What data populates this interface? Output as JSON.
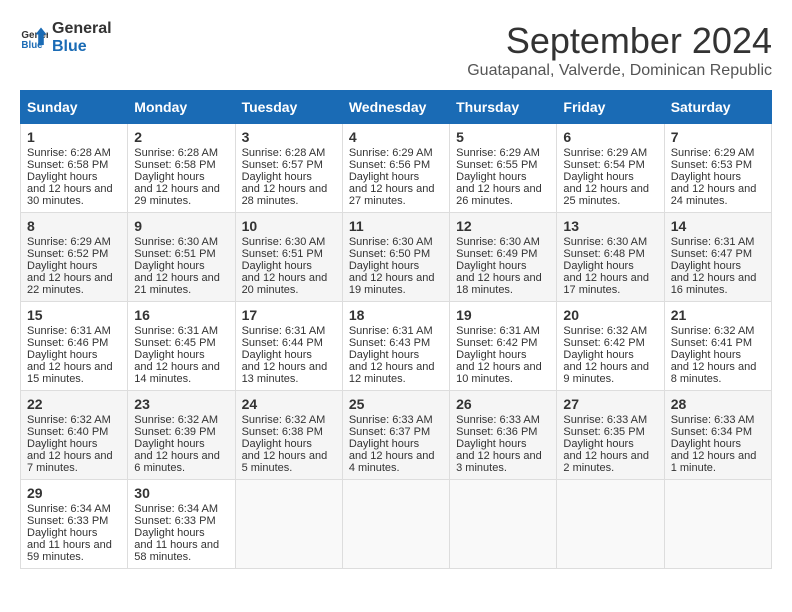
{
  "logo": {
    "line1": "General",
    "line2": "Blue"
  },
  "title": "September 2024",
  "subtitle": "Guatapanal, Valverde, Dominican Republic",
  "weekdays": [
    "Sunday",
    "Monday",
    "Tuesday",
    "Wednesday",
    "Thursday",
    "Friday",
    "Saturday"
  ],
  "weeks": [
    [
      {
        "day": "1",
        "sunrise": "6:28 AM",
        "sunset": "6:58 PM",
        "daylight": "12 hours and 30 minutes."
      },
      {
        "day": "2",
        "sunrise": "6:28 AM",
        "sunset": "6:58 PM",
        "daylight": "12 hours and 29 minutes."
      },
      {
        "day": "3",
        "sunrise": "6:28 AM",
        "sunset": "6:57 PM",
        "daylight": "12 hours and 28 minutes."
      },
      {
        "day": "4",
        "sunrise": "6:29 AM",
        "sunset": "6:56 PM",
        "daylight": "12 hours and 27 minutes."
      },
      {
        "day": "5",
        "sunrise": "6:29 AM",
        "sunset": "6:55 PM",
        "daylight": "12 hours and 26 minutes."
      },
      {
        "day": "6",
        "sunrise": "6:29 AM",
        "sunset": "6:54 PM",
        "daylight": "12 hours and 25 minutes."
      },
      {
        "day": "7",
        "sunrise": "6:29 AM",
        "sunset": "6:53 PM",
        "daylight": "12 hours and 24 minutes."
      }
    ],
    [
      {
        "day": "8",
        "sunrise": "6:29 AM",
        "sunset": "6:52 PM",
        "daylight": "12 hours and 22 minutes."
      },
      {
        "day": "9",
        "sunrise": "6:30 AM",
        "sunset": "6:51 PM",
        "daylight": "12 hours and 21 minutes."
      },
      {
        "day": "10",
        "sunrise": "6:30 AM",
        "sunset": "6:51 PM",
        "daylight": "12 hours and 20 minutes."
      },
      {
        "day": "11",
        "sunrise": "6:30 AM",
        "sunset": "6:50 PM",
        "daylight": "12 hours and 19 minutes."
      },
      {
        "day": "12",
        "sunrise": "6:30 AM",
        "sunset": "6:49 PM",
        "daylight": "12 hours and 18 minutes."
      },
      {
        "day": "13",
        "sunrise": "6:30 AM",
        "sunset": "6:48 PM",
        "daylight": "12 hours and 17 minutes."
      },
      {
        "day": "14",
        "sunrise": "6:31 AM",
        "sunset": "6:47 PM",
        "daylight": "12 hours and 16 minutes."
      }
    ],
    [
      {
        "day": "15",
        "sunrise": "6:31 AM",
        "sunset": "6:46 PM",
        "daylight": "12 hours and 15 minutes."
      },
      {
        "day": "16",
        "sunrise": "6:31 AM",
        "sunset": "6:45 PM",
        "daylight": "12 hours and 14 minutes."
      },
      {
        "day": "17",
        "sunrise": "6:31 AM",
        "sunset": "6:44 PM",
        "daylight": "12 hours and 13 minutes."
      },
      {
        "day": "18",
        "sunrise": "6:31 AM",
        "sunset": "6:43 PM",
        "daylight": "12 hours and 12 minutes."
      },
      {
        "day": "19",
        "sunrise": "6:31 AM",
        "sunset": "6:42 PM",
        "daylight": "12 hours and 10 minutes."
      },
      {
        "day": "20",
        "sunrise": "6:32 AM",
        "sunset": "6:42 PM",
        "daylight": "12 hours and 9 minutes."
      },
      {
        "day": "21",
        "sunrise": "6:32 AM",
        "sunset": "6:41 PM",
        "daylight": "12 hours and 8 minutes."
      }
    ],
    [
      {
        "day": "22",
        "sunrise": "6:32 AM",
        "sunset": "6:40 PM",
        "daylight": "12 hours and 7 minutes."
      },
      {
        "day": "23",
        "sunrise": "6:32 AM",
        "sunset": "6:39 PM",
        "daylight": "12 hours and 6 minutes."
      },
      {
        "day": "24",
        "sunrise": "6:32 AM",
        "sunset": "6:38 PM",
        "daylight": "12 hours and 5 minutes."
      },
      {
        "day": "25",
        "sunrise": "6:33 AM",
        "sunset": "6:37 PM",
        "daylight": "12 hours and 4 minutes."
      },
      {
        "day": "26",
        "sunrise": "6:33 AM",
        "sunset": "6:36 PM",
        "daylight": "12 hours and 3 minutes."
      },
      {
        "day": "27",
        "sunrise": "6:33 AM",
        "sunset": "6:35 PM",
        "daylight": "12 hours and 2 minutes."
      },
      {
        "day": "28",
        "sunrise": "6:33 AM",
        "sunset": "6:34 PM",
        "daylight": "12 hours and 1 minute."
      }
    ],
    [
      {
        "day": "29",
        "sunrise": "6:34 AM",
        "sunset": "6:33 PM",
        "daylight": "11 hours and 59 minutes."
      },
      {
        "day": "30",
        "sunrise": "6:34 AM",
        "sunset": "6:33 PM",
        "daylight": "11 hours and 58 minutes."
      },
      {
        "day": "",
        "sunrise": "",
        "sunset": "",
        "daylight": ""
      },
      {
        "day": "",
        "sunrise": "",
        "sunset": "",
        "daylight": ""
      },
      {
        "day": "",
        "sunrise": "",
        "sunset": "",
        "daylight": ""
      },
      {
        "day": "",
        "sunrise": "",
        "sunset": "",
        "daylight": ""
      },
      {
        "day": "",
        "sunrise": "",
        "sunset": "",
        "daylight": ""
      }
    ]
  ],
  "labels": {
    "sunrise": "Sunrise:",
    "sunset": "Sunset:",
    "daylight": "Daylight hours"
  }
}
